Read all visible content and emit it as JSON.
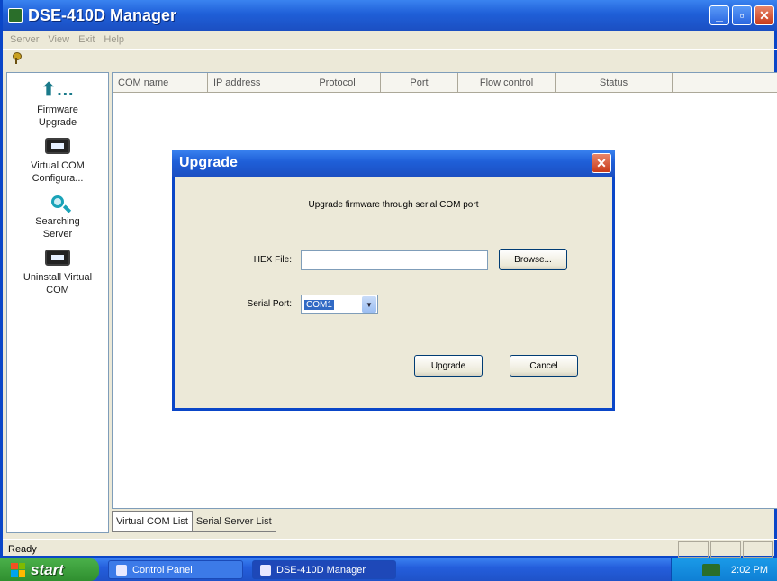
{
  "window": {
    "title": "DSE-410D Manager"
  },
  "menu": [
    "Server",
    "View",
    "Exit",
    "Help"
  ],
  "sidebar": {
    "items": [
      {
        "label": "Firmware Upgrade",
        "icon": "upgrade-icon"
      },
      {
        "label": "Virtual COM Configura...",
        "icon": "monitor-icon"
      },
      {
        "label": "Searching Server",
        "icon": "search-icon"
      },
      {
        "label": "Uninstall Virtual COM",
        "icon": "monitor-icon"
      }
    ]
  },
  "list": {
    "columns": [
      "COM name",
      "IP address",
      "Protocol",
      "Port",
      "Flow control",
      "Status"
    ]
  },
  "tabs": [
    "Virtual COM List",
    "Serial Server List"
  ],
  "status": {
    "text": "Ready"
  },
  "dialog": {
    "title": "Upgrade",
    "description": "Upgrade firmware through serial COM port",
    "hex_label": "HEX File:",
    "hex_value": "",
    "browse_label": "Browse...",
    "port_label": "Serial Port:",
    "port_value": "COM1",
    "upgrade_label": "Upgrade",
    "cancel_label": "Cancel"
  },
  "taskbar": {
    "start_label": "start",
    "items": [
      "Control Panel",
      "DSE-410D Manager"
    ],
    "clock": "2:02 PM"
  },
  "colors": {
    "title_blue": "#1f5fd8",
    "taskbar_blue": "#245edc",
    "start_green": "#2f8f2f",
    "selection": "#316ac5"
  }
}
